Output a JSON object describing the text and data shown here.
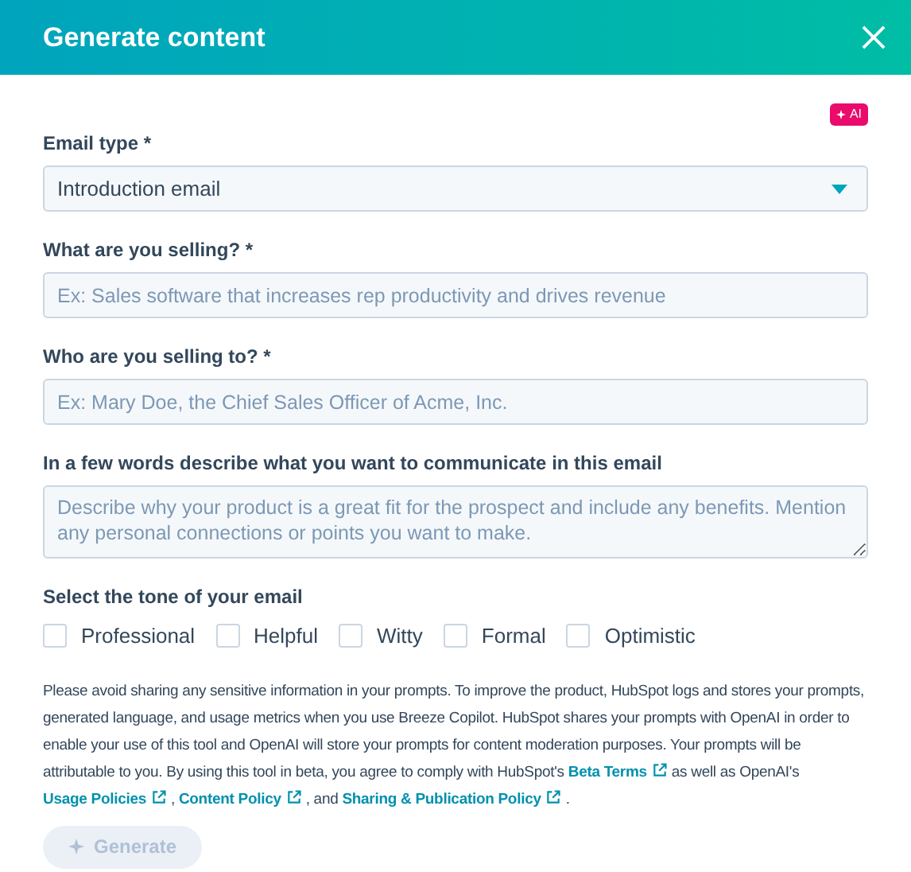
{
  "header": {
    "title": "Generate content"
  },
  "ai_badge": "AI",
  "email_type": {
    "label": "Email type *",
    "value": "Introduction email"
  },
  "fields": [
    {
      "kind": "input",
      "label": "What are you selling? *",
      "placeholder": "Ex: Sales software that increases rep productivity and drives revenue"
    },
    {
      "kind": "input",
      "label": "Who are you selling to? *",
      "placeholder": "Ex: Mary Doe, the Chief Sales Officer of Acme, Inc."
    },
    {
      "kind": "textarea",
      "label": "In a few words describe what you want to communicate in this email",
      "placeholder": "Describe why your product is a great fit for the prospect and include any benefits. Mention any personal connections or points you want to make."
    }
  ],
  "tone": {
    "label": "Select the tone of your email",
    "options": [
      {
        "label": "Professional",
        "checked": false
      },
      {
        "label": "Helpful",
        "checked": false
      },
      {
        "label": "Witty",
        "checked": false
      },
      {
        "label": "Formal",
        "checked": false
      },
      {
        "label": "Optimistic",
        "checked": false
      }
    ]
  },
  "disclaimer": [
    {
      "kind": "text",
      "text": "Please avoid sharing any sensitive information in your prompts. To improve the product, HubSpot logs and stores your prompts, generated language, and usage metrics when you use Breeze Copilot. HubSpot shares your prompts with OpenAI in order to enable your use of this tool and OpenAI will store your prompts for content moderation purposes. Your prompts will be attributable to you. By using this tool in beta, you agree to comply with HubSpot's "
    },
    {
      "kind": "link",
      "text": "Beta Terms"
    },
    {
      "kind": "text",
      "text": " as well as OpenAI's "
    },
    {
      "kind": "link",
      "text": "Usage Policies"
    },
    {
      "kind": "text",
      "text": " , "
    },
    {
      "kind": "link",
      "text": "Content Policy"
    },
    {
      "kind": "text",
      "text": " , and "
    },
    {
      "kind": "link",
      "text": "Sharing & Publication Policy"
    },
    {
      "kind": "text",
      "text": " ."
    }
  ],
  "generate_button": {
    "label": "Generate",
    "disabled": true
  }
}
